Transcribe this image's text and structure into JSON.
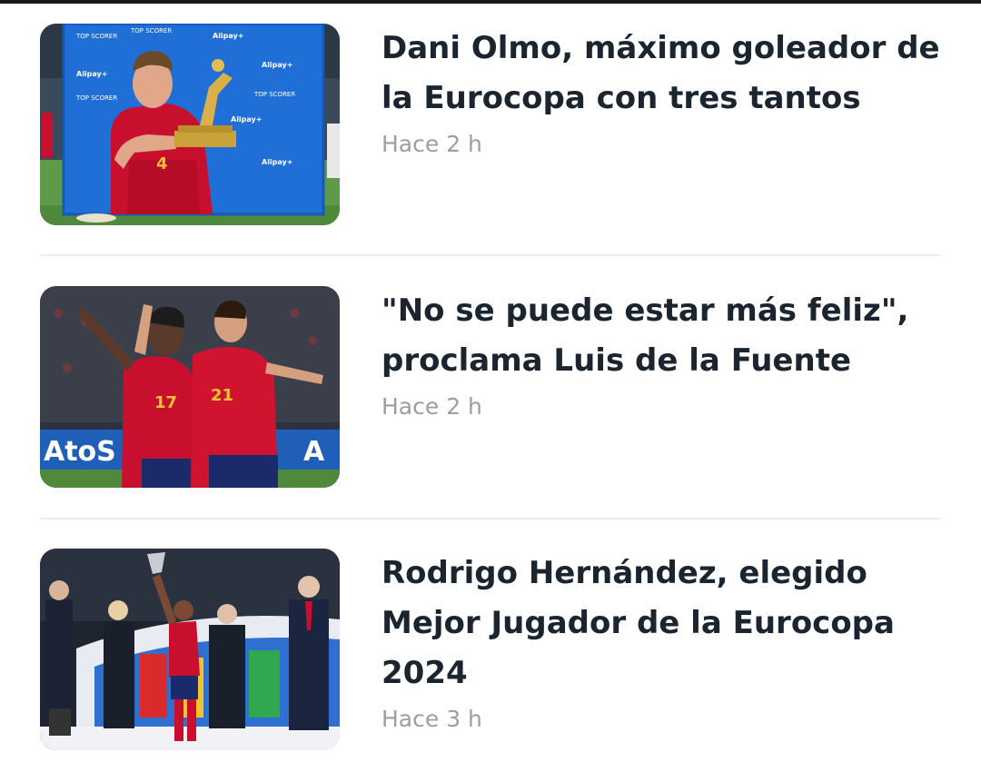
{
  "articles": [
    {
      "headline": "Dani Olmo, máximo goleador de la Eurocopa con tres tantos",
      "time": "Hace 2 h",
      "image_text": {
        "board_1": "TOP SCORER",
        "board_2": "Alipay+",
        "shirt_number": "4"
      }
    },
    {
      "headline": "\"No se puede estar más feliz\", proclama Luis de la Fuente",
      "time": "Hace 2 h",
      "image_text": {
        "sponsor": "AtoS",
        "sponsor_right": "A",
        "number_left": "17",
        "number_right": "21"
      }
    },
    {
      "headline": "Rodrigo Hernández, elegido Mejor Jugador de la Eurocopa 2024",
      "time": "Hace 3 h",
      "image_text": {}
    }
  ],
  "colors": {
    "headline": "#1b2530",
    "timestamp": "#9a9fa5",
    "divider": "#ebedef",
    "spain_red": "#c8102e",
    "board_blue": "#1f6fd6"
  }
}
